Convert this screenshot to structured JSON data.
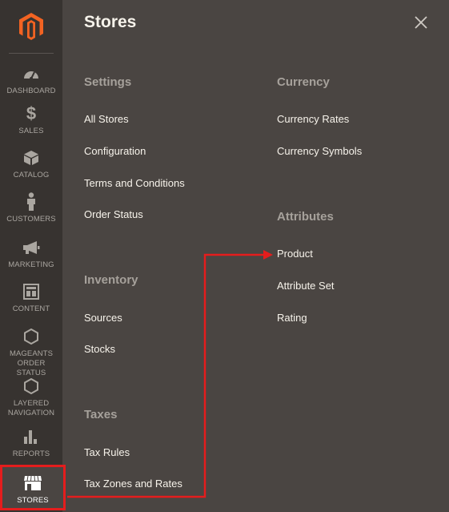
{
  "sidebar": {
    "logo_icon": "magento-logo-icon",
    "items": [
      {
        "label": "DASHBOARD",
        "icon": "dashboard-icon"
      },
      {
        "label": "SALES",
        "icon": "dollar-icon"
      },
      {
        "label": "CATALOG",
        "icon": "box-icon"
      },
      {
        "label": "CUSTOMERS",
        "icon": "person-icon"
      },
      {
        "label": "MARKETING",
        "icon": "megaphone-icon"
      },
      {
        "label": "CONTENT",
        "icon": "layout-icon"
      },
      {
        "label": "MAGEANTS ORDER STATUS",
        "icon": "hexagon-icon"
      },
      {
        "label": "LAYERED NAVIGATION",
        "icon": "hexagon-icon"
      },
      {
        "label": "REPORTS",
        "icon": "bar-chart-icon"
      },
      {
        "label": "STORES",
        "icon": "store-icon",
        "active": true
      }
    ]
  },
  "panel": {
    "title": "Stores",
    "close_icon": "close-icon",
    "sections": {
      "settings": {
        "title": "Settings",
        "items": [
          "All Stores",
          "Configuration",
          "Terms and Conditions",
          "Order Status"
        ]
      },
      "inventory": {
        "title": "Inventory",
        "items": [
          "Sources",
          "Stocks"
        ]
      },
      "taxes": {
        "title": "Taxes",
        "items": [
          "Tax Rules",
          "Tax Zones and Rates"
        ]
      },
      "currency": {
        "title": "Currency",
        "items": [
          "Currency Rates",
          "Currency Symbols"
        ]
      },
      "attributes": {
        "title": "Attributes",
        "items": [
          "Product",
          "Attribute Set",
          "Rating"
        ]
      }
    }
  },
  "annotation": {
    "color": "#e41d1d"
  }
}
